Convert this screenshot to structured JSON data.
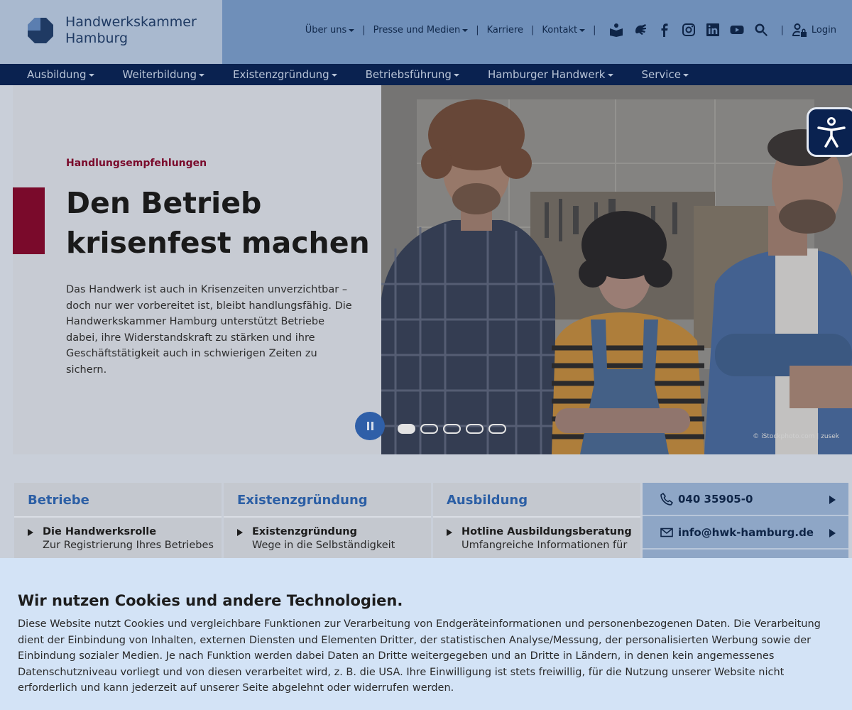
{
  "brand": {
    "name_line1": "Handwerkskammer",
    "name_line2": "Hamburg"
  },
  "meta_nav": {
    "items": [
      {
        "label": "Über uns",
        "dropdown": true
      },
      {
        "label": "Presse und Medien",
        "dropdown": true
      },
      {
        "label": "Karriere",
        "dropdown": false
      },
      {
        "label": "Kontakt",
        "dropdown": true
      }
    ],
    "separator": "|",
    "icons": [
      "easy-language-icon",
      "sign-language-icon",
      "facebook-icon",
      "instagram-icon",
      "linkedin-icon",
      "youtube-icon",
      "search-icon"
    ],
    "login_label": "Login"
  },
  "main_nav": {
    "items": [
      "Ausbildung",
      "Weiterbildung",
      "Existenzgründung",
      "Betriebsführung",
      "Hamburger Handwerk",
      "Service"
    ]
  },
  "hero": {
    "kicker": "Handlungsempfehlungen",
    "headline_line1": "Den Betrieb",
    "headline_line2": "krisenfest machen",
    "lead": "Das Handwerk ist auch in Krisenzeiten unverzichtbar – doch nur wer vorbereitet ist, bleibt handlungsfähig. Die Handwerkskammer Hamburg unterstützt Betriebe dabei, ihre Widerstandskraft zu stärken und ihre Geschäftstätigkeit auch in schwierigen Zeiten zu sichern.",
    "image_credit": "© iStockphoto.com | zusek",
    "slides_total": 5,
    "slide_active": 1
  },
  "cards": [
    {
      "title": "Betriebe",
      "entry_title": "Die Handwerksrolle",
      "entry_sub": "Zur Registrierung Ihres Betriebes"
    },
    {
      "title": "Existenzgründung",
      "entry_title": "Existenzgründung",
      "entry_sub": "Wege in die Selbständigkeit"
    },
    {
      "title": "Ausbildung",
      "entry_title": "Hotline Ausbildungsberatung",
      "entry_sub": "Umfangreiche Informationen für"
    }
  ],
  "contact": {
    "phone": "040 35905-0",
    "email": "info@hwk-hamburg.de"
  },
  "cookie": {
    "title": "Wir nutzen Cookies und andere Technologien.",
    "text": "Diese Website nutzt Cookies und vergleichbare Funktionen zur Verarbeitung von Endgeräteinformationen und personenbezogenen Daten. Die Verarbeitung dient der Einbindung von Inhalten, externen Diensten und Elementen Dritter, der statistischen Analyse/Messung, der personalisierten Werbung sowie der Einbindung sozialer Medien. Je nach Funktion werden dabei Daten an Dritte weitergegeben und an Dritte in Ländern, in denen kein angemessenes Datenschutzniveau vorliegt und von diesen verarbeitet wird, z. B. die USA. Ihre Einwilligung ist stets freiwillig, für die Nutzung unserer Website nicht erforderlich und kann jederzeit auf unserer Seite abgelehnt oder widerrufen werden."
  },
  "colors": {
    "navy": "#0a2250",
    "burgundy": "#7a0a2b",
    "link_blue": "#2c5fa5",
    "cookie_bg": "#d3e3f6"
  }
}
